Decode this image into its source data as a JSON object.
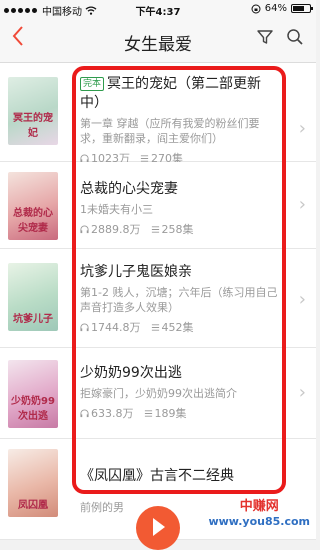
{
  "status": {
    "carrier": "中国移动",
    "time": "下午4:37",
    "battery": "64%",
    "battery_level": 0.64
  },
  "header": {
    "back_icon": "chevron-left-icon",
    "title": "女生最爱",
    "filter_icon": "filter-icon",
    "search_icon": "search-icon"
  },
  "colors": {
    "accent": "#f04a38",
    "highlight": "#ea1b1b",
    "tag": "#2e9b4c"
  },
  "books": [
    {
      "cover_text": "冥王的宠妃",
      "tag": "完本",
      "title": "冥王的宠妃（第二部更新中）",
      "desc": "第一章 穿越（应所有我爱的粉丝们要求，重新翻录，阎主爱你们）",
      "plays": "1023万",
      "episodes": "270集"
    },
    {
      "cover_text": "总裁的心尖宠妻",
      "title": "总裁的心尖宠妻",
      "desc": "1未婚夫有小三",
      "plays": "2889.8万",
      "episodes": "258集"
    },
    {
      "cover_text": "坑爹儿子",
      "title": "坑爹儿子鬼医娘亲",
      "desc": "第1-2 贱人，沉塘；六年后（练习用自己声音打造多人效果）",
      "plays": "1744.8万",
      "episodes": "452集"
    },
    {
      "cover_text": "少奶奶99次出逃",
      "title": "少奶奶99次出逃",
      "desc": "拒嫁豪门，少奶奶99次出逃简介",
      "plays": "633.8万",
      "episodes": "189集"
    },
    {
      "cover_text": "凤囚凰",
      "title": "《凤囚凰》古言不二经典",
      "desc": "前例的男"
    }
  ],
  "watermark": {
    "line1": "中赚网",
    "line2": "www.you85.com"
  }
}
